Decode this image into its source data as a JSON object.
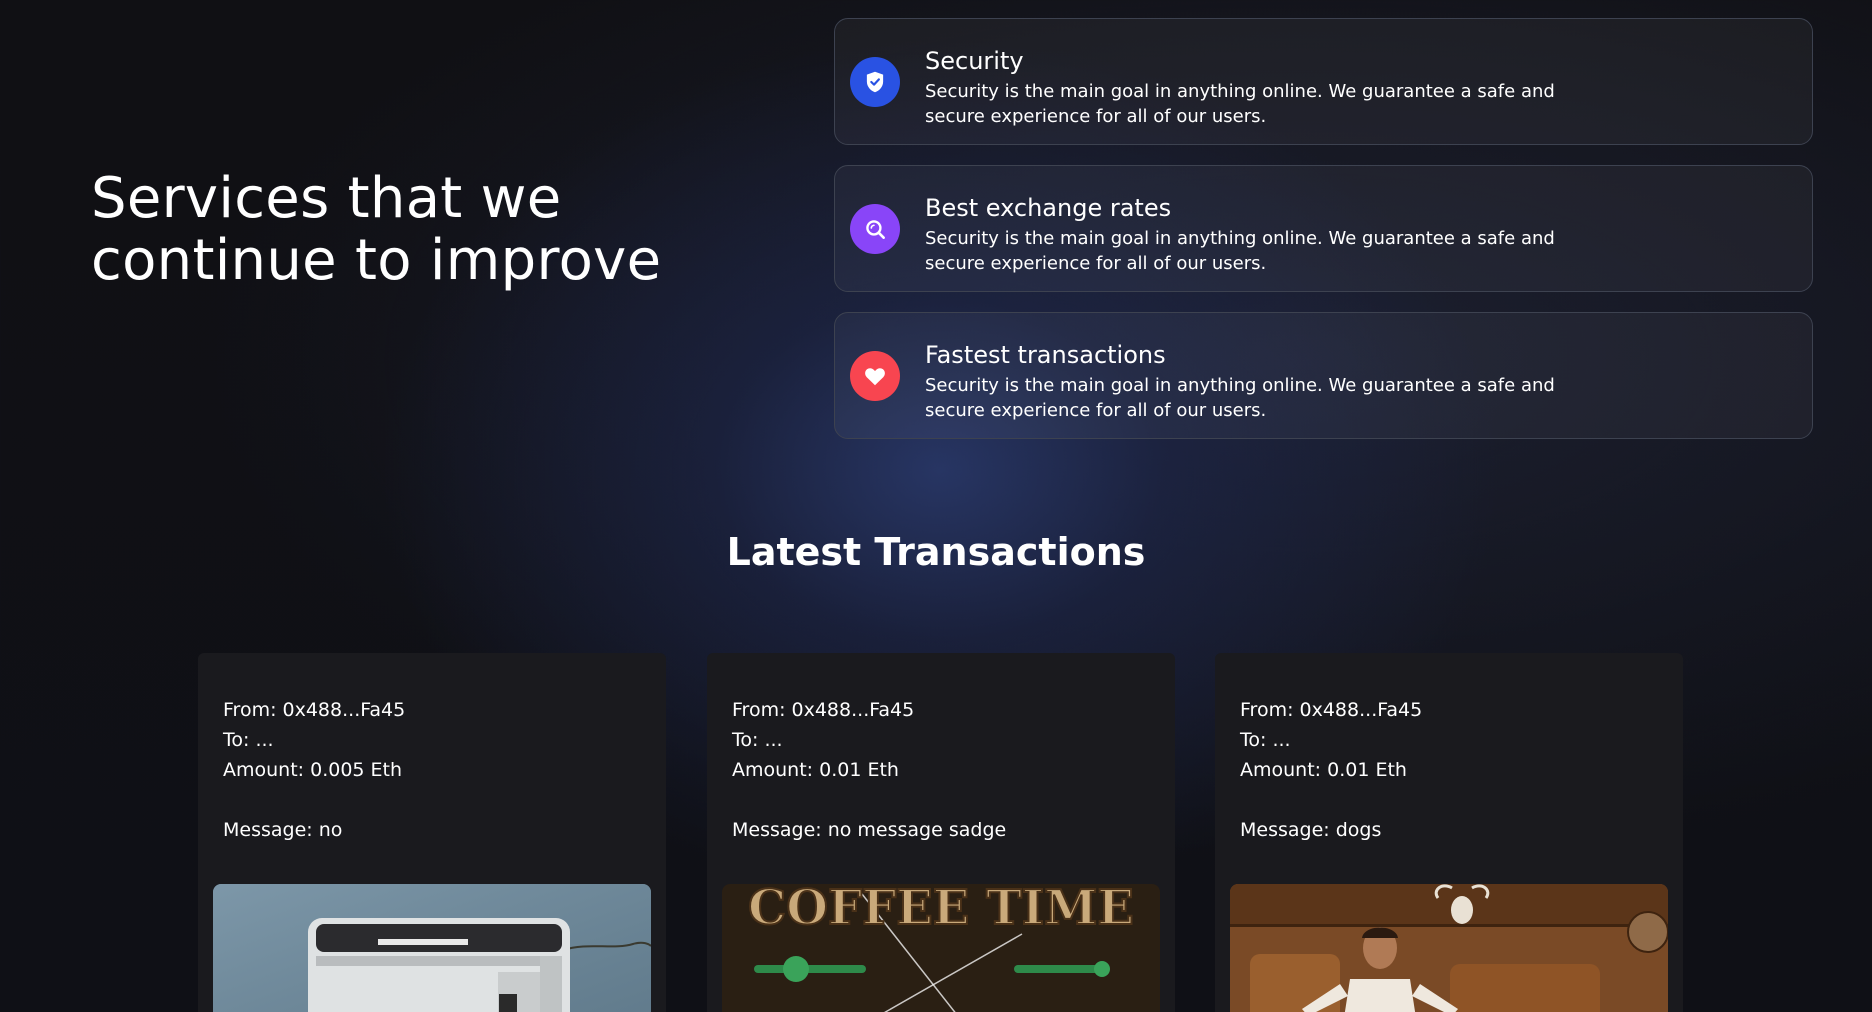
{
  "services": {
    "title": "Services that we continue to improve",
    "cards": [
      {
        "name": "Security",
        "description": "Security is the main goal in anything online. We guarantee a safe and secure experience for all of our users.",
        "icon": "shield-check-icon",
        "icon_color": "#2952e3"
      },
      {
        "name": "Best exchange rates",
        "description": "Security is the main goal in anything online. We guarantee a safe and secure experience for all of our users.",
        "icon": "search-icon",
        "icon_color": "#8945f8"
      },
      {
        "name": "Fastest transactions",
        "description": "Security is the main goal in anything online. We guarantee a safe and secure experience for all of our users.",
        "icon": "heart-icon",
        "icon_color": "#f84550"
      }
    ]
  },
  "transactions": {
    "heading": "Latest Transactions",
    "cards": [
      {
        "from": "From: 0x488...Fa45",
        "to": "To: ...",
        "amount": "Amount: 0.005 Eth",
        "message": "Message: no"
      },
      {
        "from": "From: 0x488...Fa45",
        "to": "To: ...",
        "amount": "Amount: 0.01 Eth",
        "message": "Message: no message sadge",
        "image_text": "COFFEE TIME"
      },
      {
        "from": "From: 0x488...Fa45",
        "to": "To: ...",
        "amount": "Amount: 0.01 Eth",
        "message": "Message: dogs"
      }
    ]
  }
}
